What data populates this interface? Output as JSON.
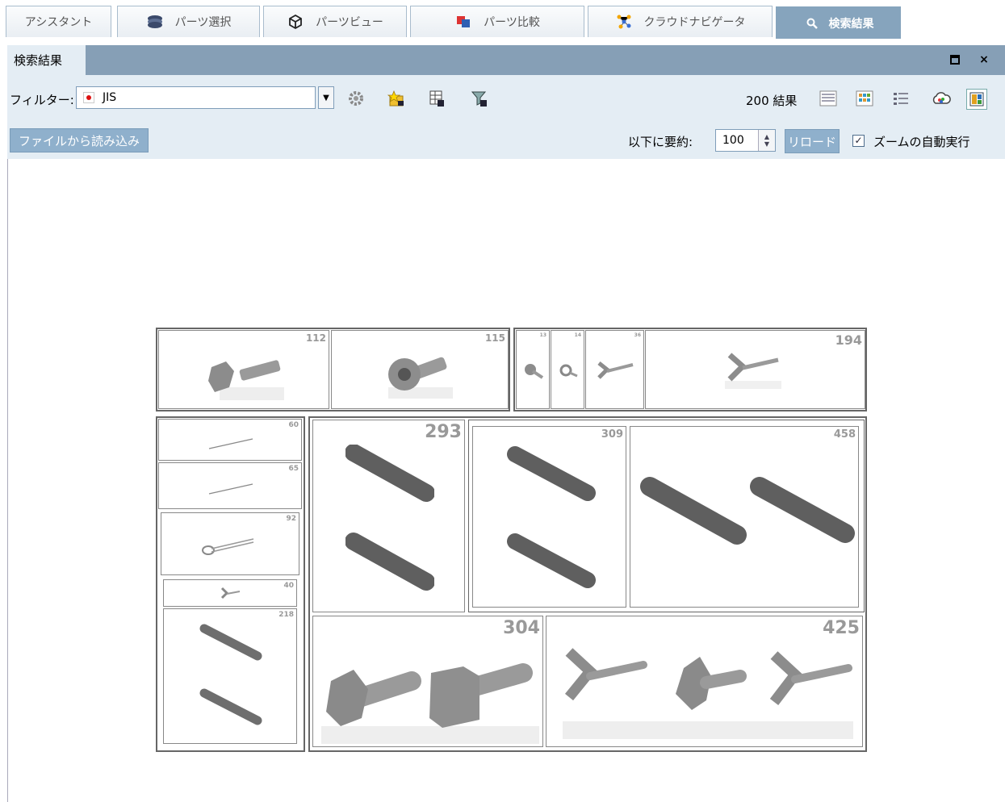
{
  "tabs": [
    {
      "label": "アシスタント",
      "icon": "none"
    },
    {
      "label": "パーツ選択",
      "icon": "parts-select-icon"
    },
    {
      "label": "パーツビュー",
      "icon": "parts-view-icon"
    },
    {
      "label": "パーツ比較",
      "icon": "parts-compare-icon"
    },
    {
      "label": "クラウドナビゲータ",
      "icon": "cloud-navigator-icon"
    },
    {
      "label": "検索結果",
      "icon": "search-icon"
    }
  ],
  "panel": {
    "title": "検索結果",
    "maximize_icon": "maximize-icon",
    "close_label": "×"
  },
  "toolbar": {
    "filter_label": "フィルター:",
    "filter_value": "JIS",
    "count_text": "200 結果",
    "load_file_label": "ファイルから読み込み",
    "summarize_label": "以下に要約:",
    "summarize_value": "100",
    "reload_label": "リロード",
    "auto_zoom_label": "ズームの自動実行",
    "auto_zoom_checked": true
  },
  "results": [
    {
      "id": "112"
    },
    {
      "id": "115"
    },
    {
      "id": "13"
    },
    {
      "id": "14"
    },
    {
      "id": "36"
    },
    {
      "id": "194"
    },
    {
      "id": "60"
    },
    {
      "id": "65"
    },
    {
      "id": "92"
    },
    {
      "id": "40"
    },
    {
      "id": "218"
    },
    {
      "id": "293"
    },
    {
      "id": "309"
    },
    {
      "id": "458"
    },
    {
      "id": "304"
    },
    {
      "id": "425"
    }
  ]
}
